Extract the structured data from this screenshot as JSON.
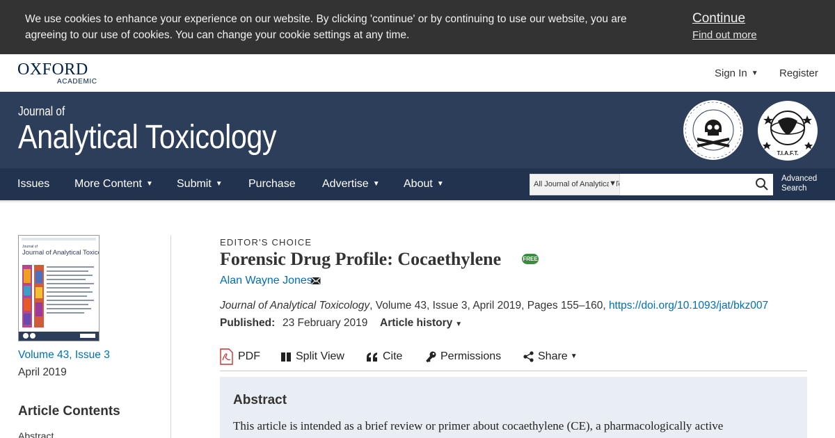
{
  "cookie_banner": {
    "text": "We use cookies to enhance your experience on our website. By clicking 'continue' or by continuing to use our website, you are agreeing to our use of cookies. You can change your cookie settings at any time.",
    "continue_label": "Continue",
    "find_out_more_label": "Find out more"
  },
  "topbar": {
    "logo_main": "OXFORD",
    "logo_sub": "ACADEMIC",
    "sign_in_label": "Sign In",
    "register_label": "Register"
  },
  "journal": {
    "prefix": "Journal of",
    "name": "Analytical Toxicology",
    "society_logo_text": "Society of Forensic Toxicologists Inc.",
    "tiaft_logo_text": "T.I.A.F.T."
  },
  "nav": {
    "items": [
      {
        "label": "Issues",
        "has_menu": false
      },
      {
        "label": "More Content",
        "has_menu": true
      },
      {
        "label": "Submit",
        "has_menu": true
      },
      {
        "label": "Purchase",
        "has_menu": false
      },
      {
        "label": "Advertise",
        "has_menu": true
      },
      {
        "label": "About",
        "has_menu": true
      }
    ],
    "search_scope": "All Journal of Analytical Toxicology",
    "search_placeholder": "",
    "advanced_search_line1": "Advanced",
    "advanced_search_line2": "Search"
  },
  "sidebar": {
    "cover_journal_name": "Journal of Analytical Toxicology",
    "volume_issue": "Volume 43, Issue 3",
    "issue_date": "April 2019",
    "contents_title": "Article Contents",
    "contents_items": [
      "Abstract"
    ]
  },
  "article": {
    "kicker": "EDITOR'S CHOICE",
    "title": "Forensic Drug Profile: Cocaethylene",
    "free_badge": "FREE",
    "author": "Alan Wayne Jones",
    "citation_journal": "Journal of Analytical Toxicology",
    "citation_details": ", Volume 43, Issue 3, April 2019, Pages 155–160, ",
    "doi": "https://doi.org/10.1093/jat/bkz007",
    "published_label": "Published:",
    "published_date": "23 February 2019",
    "article_history_label": "Article history",
    "tools": {
      "pdf": "PDF",
      "split_view": "Split View",
      "cite": "Cite",
      "permissions": "Permissions",
      "share": "Share"
    },
    "abstract_heading": "Abstract",
    "abstract_text": "This article is intended as a brief review or primer about cocaethylene (CE), a pharmacologically active"
  },
  "colors": {
    "cookie_bg": "#333333",
    "journal_header": "#2d3e5b",
    "nav_bg": "#223350",
    "link": "#006fb7",
    "free_badge": "#3a8d3c",
    "abstract_bg": "#e9eef4"
  }
}
